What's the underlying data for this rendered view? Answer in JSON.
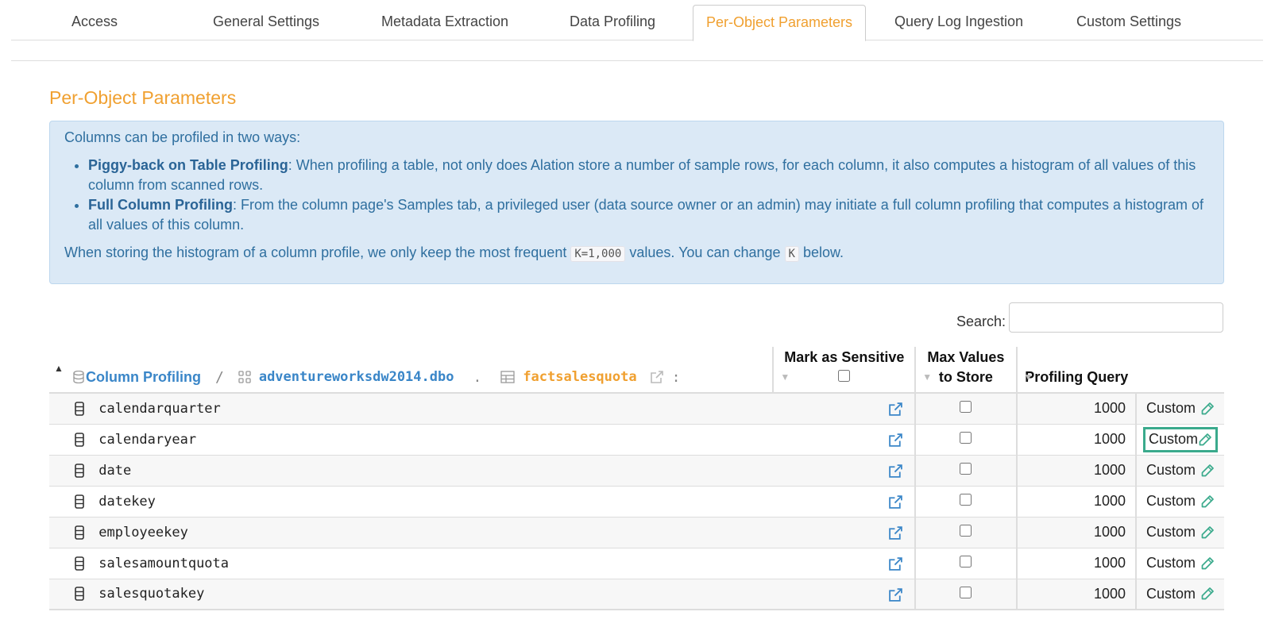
{
  "tabs": [
    {
      "label": "Access"
    },
    {
      "label": "General Settings"
    },
    {
      "label": "Metadata Extraction"
    },
    {
      "label": "Data Profiling"
    },
    {
      "label": "Per-Object Parameters"
    },
    {
      "label": "Query Log Ingestion"
    },
    {
      "label": "Custom Settings"
    }
  ],
  "active_tab": "Per-Object Parameters",
  "section_title": "Per-Object Parameters",
  "info": {
    "intro": "Columns can be profiled in two ways:",
    "items": [
      {
        "title": "Piggy-back on Table Profiling",
        "text": ": When profiling a table, not only does Alation store a number of sample rows, for each column, it also computes a histogram of all values of this column from scanned rows."
      },
      {
        "title": "Full Column Profiling",
        "text": ": From the column page's Samples tab, a privileged user (data source owner or an admin) may initiate a full column profiling that computes a histogram of all values of this column."
      }
    ],
    "footer_pre": "When storing the histogram of a column profile, we only keep the most frequent ",
    "footer_code1": "K=1,000",
    "footer_mid": " values. You can change ",
    "footer_code2": "K",
    "footer_post": " below."
  },
  "search": {
    "label": "Search:",
    "value": ""
  },
  "breadcrumb": {
    "root": "Column Profiling",
    "sep1": "/",
    "schema": "adventureworksdw2014.dbo",
    "sep2": ".",
    "table": "factsalesquota",
    "sep3": ":"
  },
  "columns": {
    "sensitive": "Mark as Sensitive",
    "max_values": "Max Values to Store",
    "profiling_query": "Profiling Query"
  },
  "rows": [
    {
      "name": "calendarquarter",
      "max": "1000",
      "query": "Custom"
    },
    {
      "name": "calendaryear",
      "max": "1000",
      "query": "Custom"
    },
    {
      "name": "date",
      "max": "1000",
      "query": "Custom"
    },
    {
      "name": "datekey",
      "max": "1000",
      "query": "Custom"
    },
    {
      "name": "employeekey",
      "max": "1000",
      "query": "Custom"
    },
    {
      "name": "salesamountquota",
      "max": "1000",
      "query": "Custom"
    },
    {
      "name": "salesquotakey",
      "max": "1000",
      "query": "Custom"
    }
  ],
  "highlighted_row": "calendaryear",
  "colors": {
    "accent": "#f0a030",
    "link": "#3a86c8",
    "info_bg": "#dbe9f6",
    "highlight": "#3aaa8c"
  }
}
